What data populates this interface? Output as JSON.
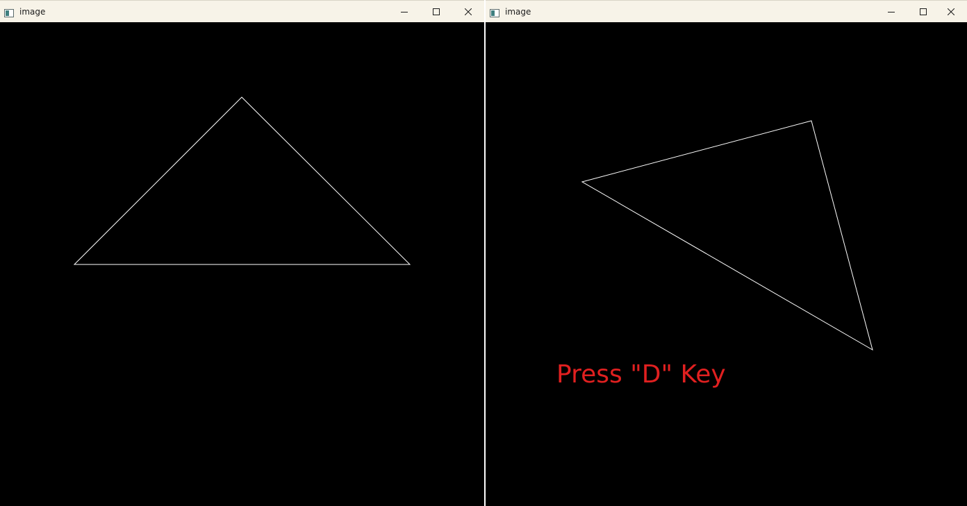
{
  "windows": {
    "left": {
      "title": "image",
      "controls": {
        "minimize": "minimize-icon",
        "maximize": "maximize-icon",
        "close": "close-icon"
      },
      "triangle": {
        "stroke": "#ffffff"
      }
    },
    "right": {
      "title": "image",
      "controls": {
        "minimize": "minimize-icon",
        "maximize": "maximize-icon",
        "close": "close-icon"
      },
      "triangle": {
        "stroke": "#ffffff"
      },
      "instruction": "Press \"D\" Key",
      "instruction_color": "#e02020"
    }
  }
}
